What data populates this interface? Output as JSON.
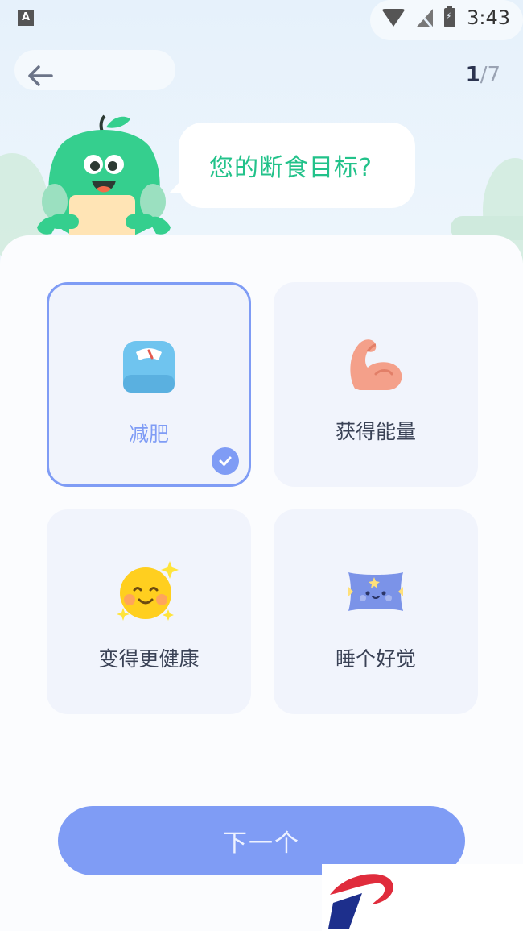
{
  "status_bar": {
    "app_indicator": "A",
    "time": "3:43",
    "icons": [
      "wifi-icon",
      "no-signal-icon",
      "battery-charging-icon"
    ]
  },
  "header": {
    "back_icon": "arrow-left-icon",
    "progress_current": "1",
    "progress_total": "/7"
  },
  "prompt": {
    "question": "您的断食目标?"
  },
  "options": [
    {
      "label": "减肥",
      "icon": "scale-icon",
      "selected": true
    },
    {
      "label": "获得能量",
      "icon": "muscle-arm-icon",
      "selected": false
    },
    {
      "label": "变得更健康",
      "icon": "smiley-sun-icon",
      "selected": false
    },
    {
      "label": "睡个好觉",
      "icon": "pillow-icon",
      "selected": false
    }
  ],
  "next_button": {
    "label": "下一个"
  },
  "colors": {
    "accent": "#7f9cf5",
    "question_green": "#22c28a",
    "card_bg": "#f1f4fc",
    "mascot_green": "#35cf8e"
  }
}
